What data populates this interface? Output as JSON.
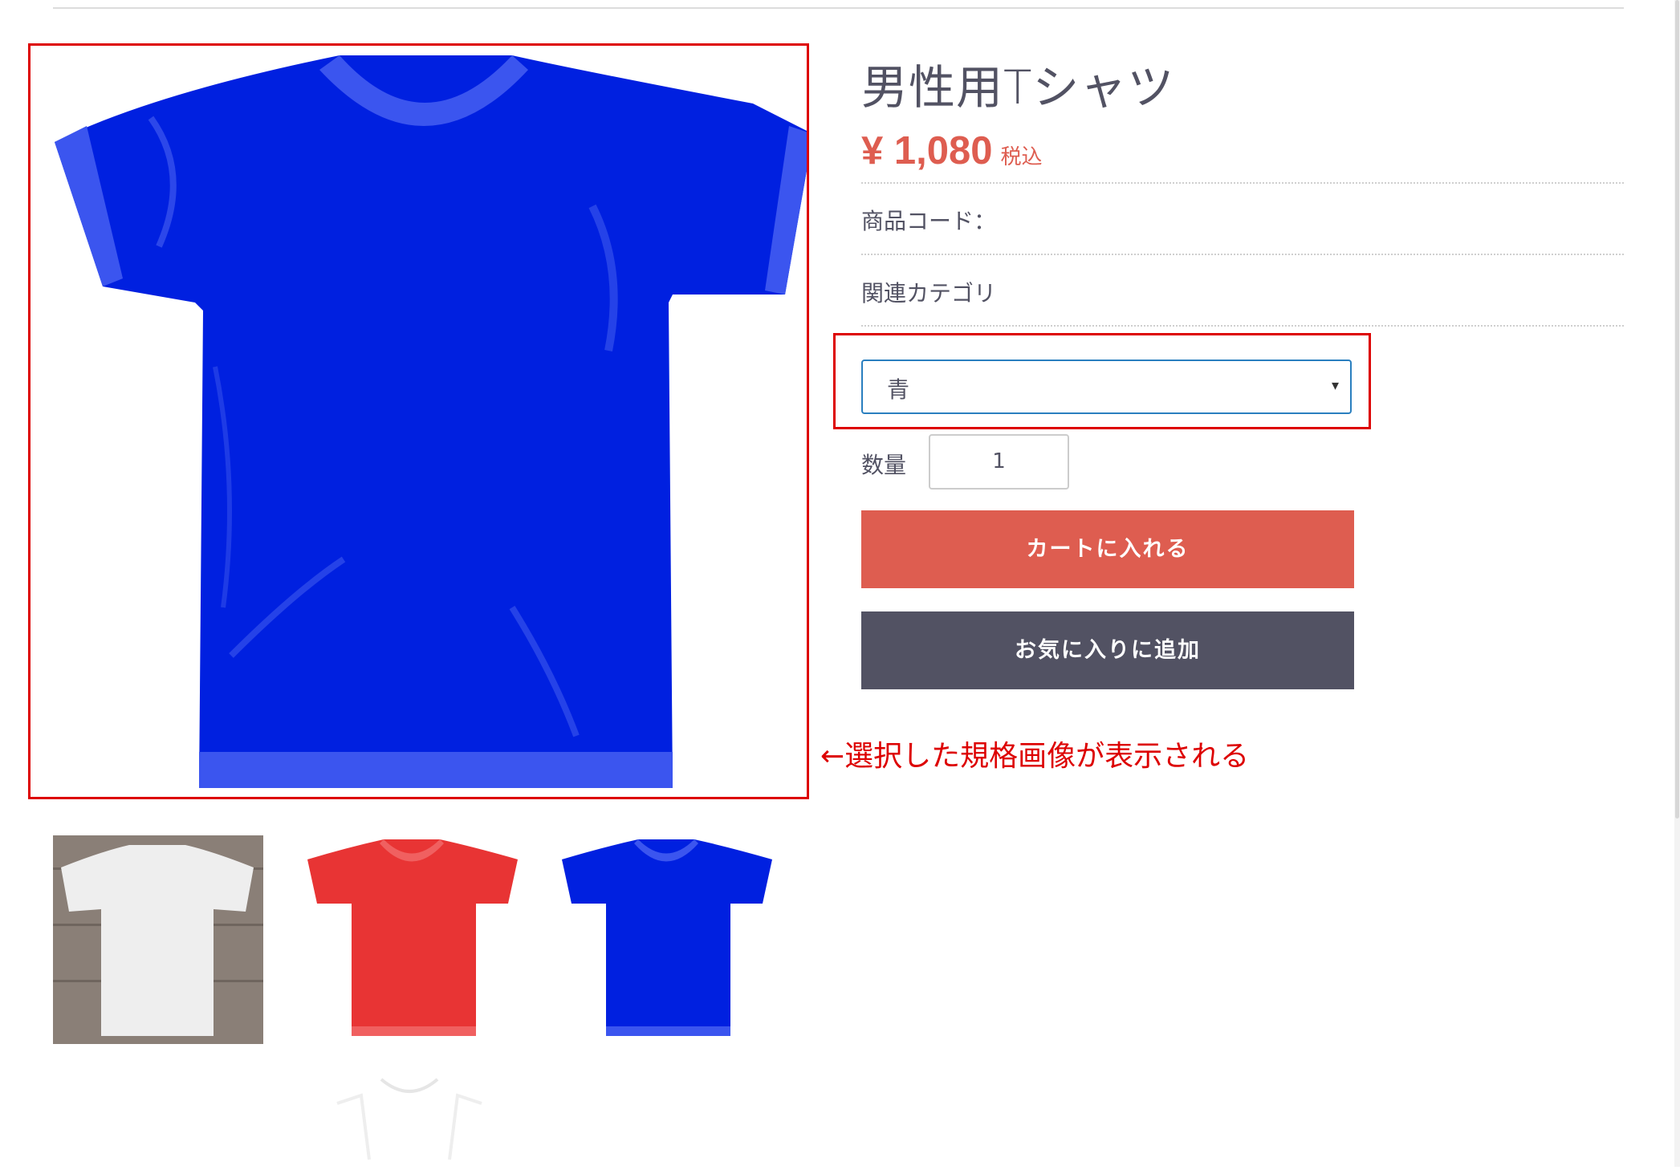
{
  "product": {
    "title": "男性用Tシャツ",
    "price": "¥ 1,080",
    "tax_label": "税込",
    "code_label": "商品コード：",
    "category_label": "関連カテゴリ"
  },
  "variant_select": {
    "selected": "青",
    "caret": "▾"
  },
  "quantity": {
    "label": "数量",
    "value": "1"
  },
  "buttons": {
    "add_to_cart": "カートに入れる",
    "add_to_favorites": "お気に入りに追加"
  },
  "annotation": "←選択した規格画像が表示される",
  "thumbnails": [
    {
      "variant": "white",
      "color": "#eeeeee",
      "background": "#8a7f77"
    },
    {
      "variant": "red",
      "color": "#e83434",
      "background": "#ffffff"
    },
    {
      "variant": "blue",
      "color": "#0020e0",
      "background": "#ffffff"
    }
  ],
  "colors": {
    "accent": "#de5d50",
    "dark_button": "#525263",
    "highlight": "#dd0000",
    "shirt_blue": "#0020e0"
  }
}
